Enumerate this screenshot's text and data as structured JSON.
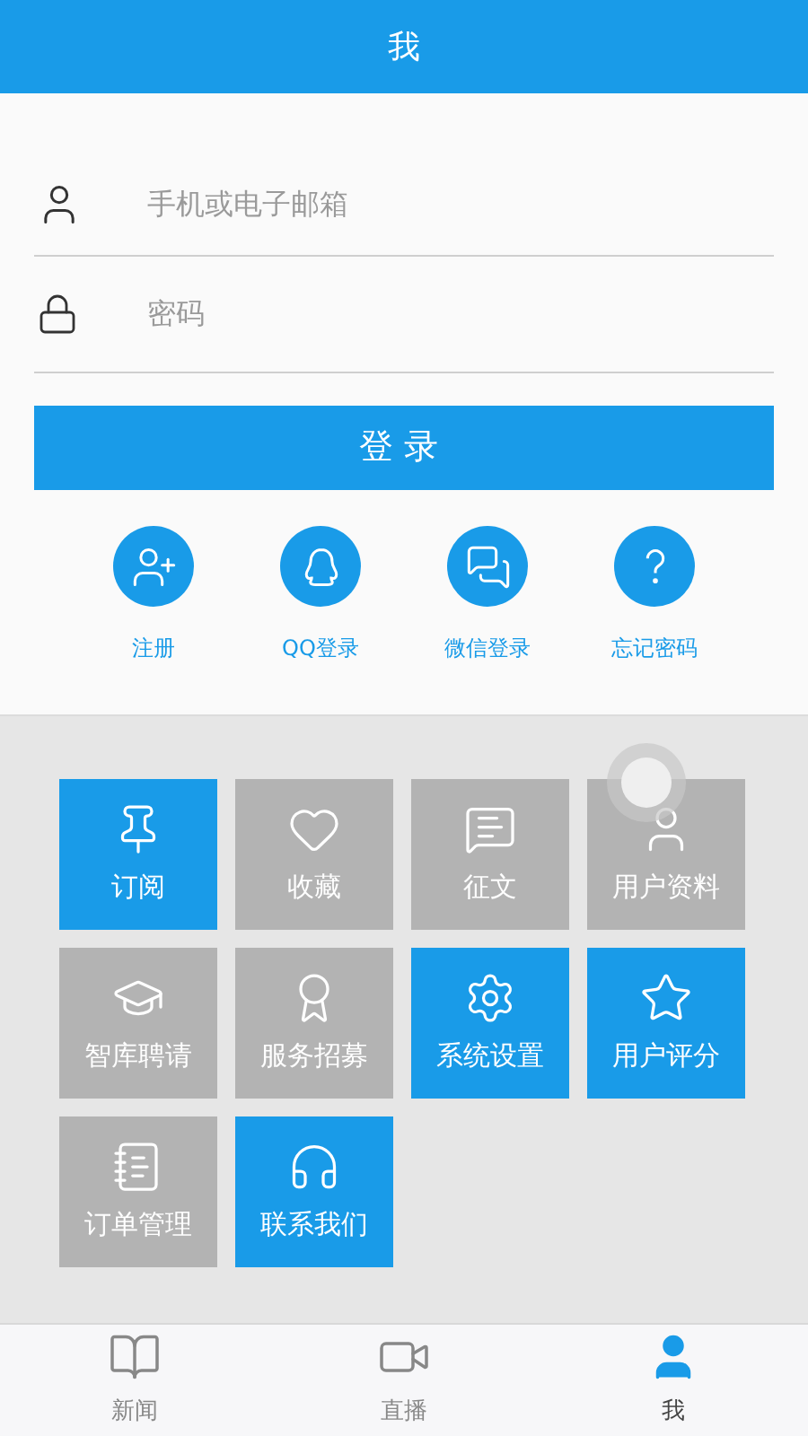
{
  "header": {
    "title": "我"
  },
  "login_form": {
    "account_field": {
      "placeholder": "手机或电子邮箱"
    },
    "password_field": {
      "placeholder": "密码"
    },
    "login_button": "登录"
  },
  "quick_links": [
    {
      "kind": "register",
      "label": "注册"
    },
    {
      "kind": "qq",
      "label": "QQ登录"
    },
    {
      "kind": "wechat",
      "label": "微信登录"
    },
    {
      "kind": "forgot",
      "label": "忘记密码"
    }
  ],
  "tiles": [
    {
      "kind": "pin",
      "label": "订阅",
      "color": "#199be8"
    },
    {
      "kind": "heart",
      "label": "收藏",
      "color": "#b3b3b3"
    },
    {
      "kind": "message",
      "label": "征文",
      "color": "#b3b3b3"
    },
    {
      "kind": "user",
      "label": "用户资料",
      "color": "#b3b3b3"
    },
    {
      "kind": "cap",
      "label": "智库聘请",
      "color": "#b3b3b3"
    },
    {
      "kind": "award",
      "label": "服务招募",
      "color": "#b3b3b3"
    },
    {
      "kind": "gear",
      "label": "系统设置",
      "color": "#199be8"
    },
    {
      "kind": "star",
      "label": "用户评分",
      "color": "#199be8"
    },
    {
      "kind": "notepad",
      "label": "订单管理",
      "color": "#b3b3b3"
    },
    {
      "kind": "headset",
      "label": "联系我们",
      "color": "#199be8"
    }
  ],
  "tab_bar": [
    {
      "kind": "news",
      "label": "新闻",
      "selected": false
    },
    {
      "kind": "live",
      "label": "直播",
      "selected": false
    },
    {
      "kind": "me",
      "label": "我",
      "selected": true
    }
  ]
}
